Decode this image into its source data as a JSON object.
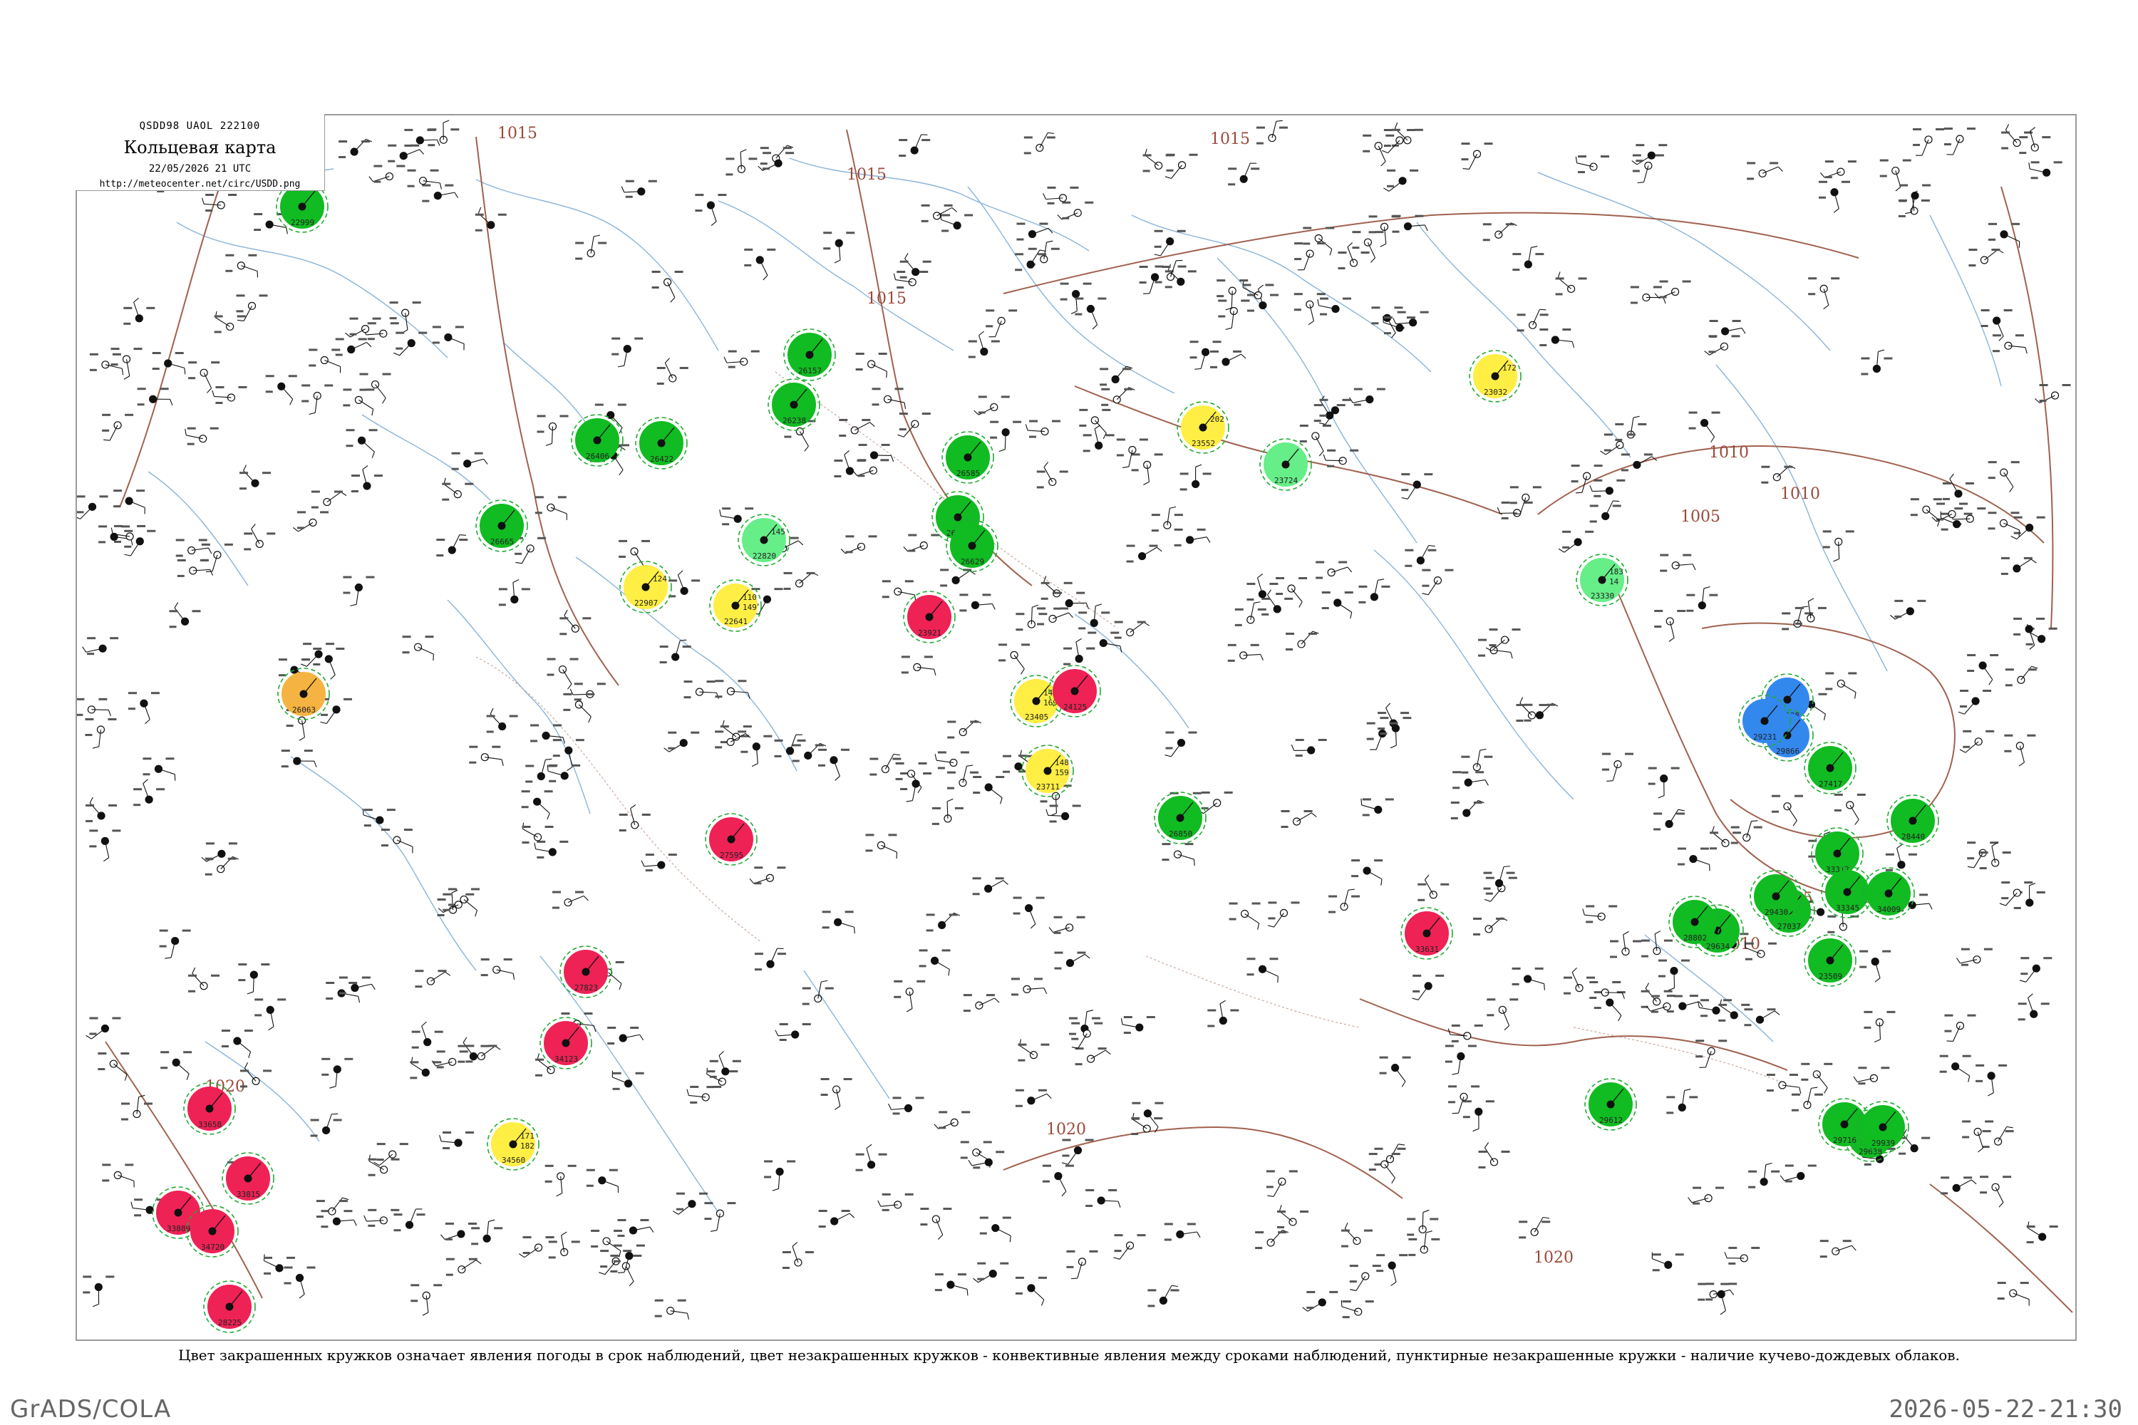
{
  "header": {
    "code": "QSDD98  UAOL  222100",
    "title": "Кольцевая карта",
    "date": "22/05/2026 21 UTC",
    "url": "http://meteocenter.net/circ/USDD.png"
  },
  "isobars": [
    {
      "label": "1015"
    },
    {
      "label": "1015"
    },
    {
      "label": "1015"
    },
    {
      "label": "1015"
    },
    {
      "label": "1010"
    },
    {
      "label": "1010"
    },
    {
      "label": "1005"
    },
    {
      "label": "1005"
    },
    {
      "label": "1010"
    },
    {
      "label": "1020"
    },
    {
      "label": "1020"
    },
    {
      "label": "1020"
    }
  ],
  "colors": {
    "precip": "#11bb22",
    "drizzle": "#66ee88",
    "fog": "#ffee44",
    "haze": "#f5b342",
    "thunder": "#ee2255",
    "shower": "#3388ee",
    "cb_cloud": "#22aa33",
    "coast": "#8ab4d8",
    "isobar": "#a0614f"
  },
  "stations": [
    {
      "type": "precip",
      "p": "",
      "t": "",
      "n": "22999"
    },
    {
      "type": "precip",
      "p": "",
      "t": "",
      "n": "26157"
    },
    {
      "type": "precip",
      "p": "",
      "t": "",
      "n": "26238"
    },
    {
      "type": "precip",
      "p": "",
      "t": "",
      "n": "26406"
    },
    {
      "type": "precip",
      "p": "",
      "t": "",
      "n": "26422"
    },
    {
      "type": "precip",
      "p": "",
      "t": "",
      "n": "26477"
    },
    {
      "type": "precip",
      "p": "",
      "t": "",
      "n": "26585"
    },
    {
      "type": "precip",
      "p": "",
      "t": "",
      "n": "26629"
    },
    {
      "type": "precip",
      "p": "",
      "t": "",
      "n": "26665"
    },
    {
      "type": "precip",
      "p": "",
      "t": "",
      "n": "26850"
    },
    {
      "type": "precip",
      "p": "",
      "t": "",
      "n": "27037"
    },
    {
      "type": "precip",
      "p": "",
      "t": "",
      "n": "27417"
    },
    {
      "type": "precip",
      "p": "",
      "t": "",
      "n": "33317"
    },
    {
      "type": "precip",
      "p": "",
      "t": "",
      "n": "33345"
    },
    {
      "type": "precip",
      "p": "",
      "t": "",
      "n": "34009"
    },
    {
      "type": "precip",
      "p": "",
      "t": "",
      "n": "23509"
    },
    {
      "type": "precip",
      "p": "",
      "t": "",
      "n": "28440"
    },
    {
      "type": "precip",
      "p": "",
      "t": "",
      "n": "29634"
    },
    {
      "type": "precip",
      "p": "",
      "t": "",
      "n": "29612"
    },
    {
      "type": "precip",
      "p": "",
      "t": "",
      "n": "29638"
    },
    {
      "type": "precip",
      "p": "",
      "t": "",
      "n": "29716"
    },
    {
      "type": "precip",
      "p": "",
      "t": "",
      "n": "29939"
    },
    {
      "type": "precip",
      "p": "",
      "t": "",
      "n": "28802"
    },
    {
      "type": "precip",
      "p": "",
      "t": "",
      "n": "29430"
    },
    {
      "type": "drizzle",
      "p": "145",
      "t": "",
      "n": "22820"
    },
    {
      "type": "drizzle",
      "p": "183",
      "t": "14",
      "n": "23330"
    },
    {
      "type": "drizzle",
      "p": "",
      "t": "",
      "n": "23724"
    },
    {
      "type": "fog",
      "p": "124",
      "t": "",
      "n": "22907"
    },
    {
      "type": "fog",
      "p": "110",
      "t": "149",
      "n": "22641"
    },
    {
      "type": "fog",
      "p": "202",
      "t": "",
      "n": "23552"
    },
    {
      "type": "fog",
      "p": "172",
      "t": "",
      "n": "23032"
    },
    {
      "type": "fog",
      "p": "143",
      "t": "169",
      "n": "23405"
    },
    {
      "type": "fog",
      "p": "148",
      "t": "159",
      "n": "23711"
    },
    {
      "type": "fog",
      "p": "171",
      "t": "182",
      "n": "34560"
    },
    {
      "type": "haze",
      "p": "",
      "t": "",
      "n": "26063"
    },
    {
      "type": "thunder",
      "p": "",
      "t": "",
      "n": "23921"
    },
    {
      "type": "thunder",
      "p": "",
      "t": "",
      "n": "24125"
    },
    {
      "type": "thunder",
      "p": "",
      "t": "",
      "n": "27595"
    },
    {
      "type": "thunder",
      "p": "",
      "t": "",
      "n": "27823"
    },
    {
      "type": "thunder",
      "p": "",
      "t": "",
      "n": "34123"
    },
    {
      "type": "thunder",
      "p": "",
      "t": "",
      "n": "33631"
    },
    {
      "type": "thunder",
      "p": "",
      "t": "",
      "n": "33658"
    },
    {
      "type": "thunder",
      "p": "",
      "t": "",
      "n": "33815"
    },
    {
      "type": "thunder",
      "p": "",
      "t": "",
      "n": "33889"
    },
    {
      "type": "thunder",
      "p": "",
      "t": "",
      "n": "34720"
    },
    {
      "type": "thunder",
      "p": "",
      "t": "",
      "n": "28225"
    },
    {
      "type": "shower",
      "p": "",
      "t": "",
      "n": "28698"
    },
    {
      "type": "shower",
      "p": "",
      "t": "",
      "n": "29866"
    },
    {
      "type": "shower",
      "p": "",
      "t": "",
      "n": "29231"
    }
  ],
  "legend_note": "Цвет закрашенных кружков означает явления погоды в срок наблюдений, цвет незакрашенных кружков - конвективные явления между сроками наблюдений, пунктирные незакрашенные кружки - наличие кучево-дождевых облаков.",
  "footer": {
    "left": "GrADS/COLA",
    "right": "2026-05-22-21:30"
  }
}
